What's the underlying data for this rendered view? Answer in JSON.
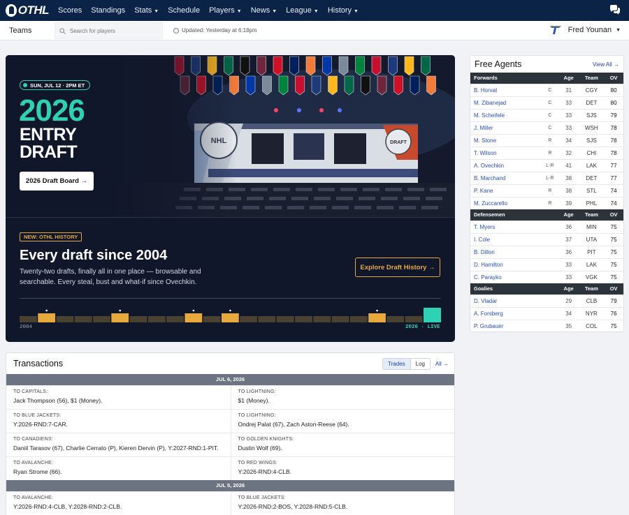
{
  "app": {
    "logo_text": "OTHL"
  },
  "nav": {
    "items": [
      {
        "label": "Scores",
        "dropdown": false
      },
      {
        "label": "Standings",
        "dropdown": false
      },
      {
        "label": "Stats",
        "dropdown": true
      },
      {
        "label": "Schedule",
        "dropdown": false
      },
      {
        "label": "Players",
        "dropdown": true
      },
      {
        "label": "News",
        "dropdown": true
      },
      {
        "label": "League",
        "dropdown": true
      },
      {
        "label": "History",
        "dropdown": true
      }
    ],
    "chat_icon": "chat-bubbles-icon"
  },
  "subbar": {
    "teams_label": "Teams",
    "search_placeholder": "Search for players",
    "updated_text": "Updated: Yesterday at 6:18pm",
    "user_name": "Fred Younan",
    "team_icon": "blues-note-icon"
  },
  "hero": {
    "date_pill": "SUN, JUL 12 · 2PM ET",
    "year": "2026",
    "title_line1": "ENTRY",
    "title_line2": "DRAFT",
    "board_button": "2026 Draft Board →",
    "new_badge": "NEW: OTHL HISTORY",
    "history_title": "Every draft since 2004",
    "history_desc": "Twenty-two drafts, finally all in one place — browsable and searchable. Every steal, bust and what-if since Ovechkin.",
    "explore_button": "Explore Draft History →",
    "timeline_start": "2004",
    "timeline_end": "2026 · LIVE",
    "timeline": {
      "count": 23,
      "highlighted": [
        1,
        5,
        9,
        11,
        19
      ],
      "dotted": [
        1,
        5,
        9,
        11,
        19
      ],
      "live_index": 22
    },
    "colors": {
      "accent": "#2fd1b4",
      "gold": "#e8a93c",
      "bg": "#10172a"
    }
  },
  "free_agents": {
    "title": "Free Agents",
    "view_all": "View All →",
    "groups": [
      {
        "heading": "Forwards",
        "cols": [
          "Age",
          "Team",
          "OV"
        ],
        "players": [
          {
            "name": "B. Horvat",
            "pos": "C",
            "age": "31",
            "team": "CGY",
            "ov": "80"
          },
          {
            "name": "M. Zibanejad",
            "pos": "C",
            "age": "33",
            "team": "DET",
            "ov": "80"
          },
          {
            "name": "M. Scheifele",
            "pos": "C",
            "age": "33",
            "team": "SJS",
            "ov": "79"
          },
          {
            "name": "J. Miller",
            "pos": "C",
            "age": "33",
            "team": "WSH",
            "ov": "78"
          },
          {
            "name": "M. Stone",
            "pos": "R",
            "age": "34",
            "team": "SJS",
            "ov": "78"
          },
          {
            "name": "T. Wilson",
            "pos": "R",
            "age": "32",
            "team": "CHI",
            "ov": "78"
          },
          {
            "name": "A. Ovechkin",
            "pos": "L-R",
            "age": "41",
            "team": "LAK",
            "ov": "77"
          },
          {
            "name": "B. Marchand",
            "pos": "L-R",
            "age": "38",
            "team": "DET",
            "ov": "77"
          },
          {
            "name": "P. Kane",
            "pos": "R",
            "age": "38",
            "team": "STL",
            "ov": "74"
          },
          {
            "name": "M. Zuccarello",
            "pos": "R",
            "age": "39",
            "team": "PHL",
            "ov": "74"
          }
        ]
      },
      {
        "heading": "Defensemen",
        "cols": [
          "Age",
          "Team",
          "OV"
        ],
        "players": [
          {
            "name": "T. Myers",
            "pos": "",
            "age": "36",
            "team": "MIN",
            "ov": "75"
          },
          {
            "name": "I. Cole",
            "pos": "",
            "age": "37",
            "team": "UTA",
            "ov": "75"
          },
          {
            "name": "B. Dillon",
            "pos": "",
            "age": "36",
            "team": "PIT",
            "ov": "75"
          },
          {
            "name": "D. Hamilton",
            "pos": "",
            "age": "33",
            "team": "LAK",
            "ov": "75"
          },
          {
            "name": "C. Parayko",
            "pos": "",
            "age": "33",
            "team": "VGK",
            "ov": "75"
          }
        ]
      },
      {
        "heading": "Goalies",
        "cols": [
          "Age",
          "Team",
          "OV"
        ],
        "players": [
          {
            "name": "D. Vladar",
            "pos": "",
            "age": "29",
            "team": "CLB",
            "ov": "79"
          },
          {
            "name": "A. Forsberg",
            "pos": "",
            "age": "34",
            "team": "NYR",
            "ov": "76"
          },
          {
            "name": "P. Grubauer",
            "pos": "",
            "age": "35",
            "team": "COL",
            "ov": "75"
          }
        ]
      }
    ]
  },
  "transactions": {
    "title": "Transactions",
    "tab_trades": "Trades",
    "tab_log": "Log",
    "all_link": "All →",
    "days": [
      {
        "date": "JUL 6, 2026",
        "rows": [
          [
            {
              "to": "TO CAPITALS:",
              "detail": "Jack Thompson (56), $1 (Money)."
            },
            {
              "to": "TO LIGHTNING:",
              "detail": "$1 (Money)."
            }
          ],
          [
            {
              "to": "TO BLUE JACKETS:",
              "detail": "Y:2026-RND:7-CAR."
            },
            {
              "to": "TO LIGHTNING:",
              "detail": "Ondrej Palat (67), Zach Aston-Reese (64)."
            }
          ],
          [
            {
              "to": "TO CANADIENS:",
              "detail": "Daniil Tarasov (67), Charlie Cerrato (P), Kieren Dervin (P), Y:2027-RND:1-PIT."
            },
            {
              "to": "TO GOLDEN KNIGHTS:",
              "detail": "Dustin Wolf (69)."
            }
          ],
          [
            {
              "to": "TO AVALANCHE:",
              "detail": "Ryan Strome (66)."
            },
            {
              "to": "TO RED WINGS:",
              "detail": "Y:2026-RND:4-CLB."
            }
          ]
        ]
      },
      {
        "date": "JUL 5, 2026",
        "rows": [
          [
            {
              "to": "TO AVALANCHE:",
              "detail": "Y:2026-RND:4-CLB, Y:2028-RND:2-CLB."
            },
            {
              "to": "TO BLUE JACKETS:",
              "detail": "Y:2026-RND:2-BOS, Y:2028-RND:5-CLB."
            }
          ]
        ]
      }
    ]
  }
}
